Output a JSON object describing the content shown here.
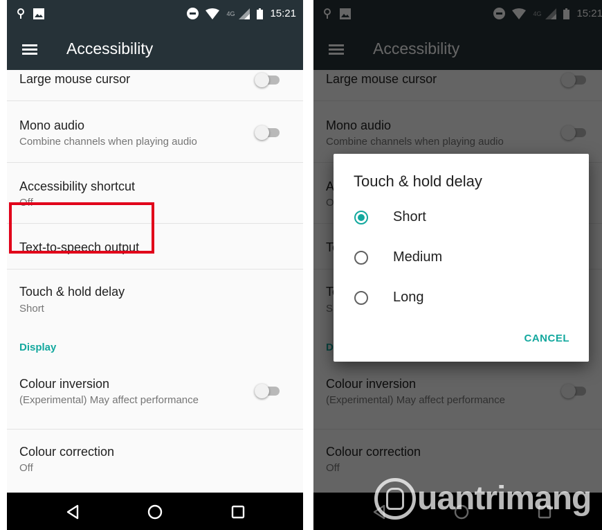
{
  "status_bar": {
    "time": "15:21",
    "network": "4G"
  },
  "app_bar": {
    "title": "Accessibility"
  },
  "settings": {
    "large_mouse_cursor": {
      "title": "Large mouse cursor"
    },
    "mono_audio": {
      "title": "Mono audio",
      "summary": "Combine channels when playing audio"
    },
    "accessibility_shortcut": {
      "title": "Accessibility shortcut",
      "summary": "Off"
    },
    "tts_output": {
      "title": "Text-to-speech output"
    },
    "touch_hold_delay": {
      "title": "Touch & hold delay",
      "summary": "Short"
    },
    "display_header": "Display",
    "colour_inversion": {
      "title": "Colour inversion",
      "summary": "(Experimental) May affect performance"
    },
    "colour_correction": {
      "title": "Colour correction",
      "summary": "Off"
    }
  },
  "dialog": {
    "title": "Touch & hold delay",
    "options": [
      {
        "label": "Short",
        "selected": true
      },
      {
        "label": "Medium",
        "selected": false
      },
      {
        "label": "Long",
        "selected": false
      }
    ],
    "cancel_label": "CANCEL"
  },
  "watermark": {
    "text": "uantrimang"
  },
  "colors": {
    "app_bar": "#263238",
    "accent": "#13a89e",
    "highlight_border": "#e1001a",
    "nav_bar": "#000000"
  },
  "icons": {
    "status_left": [
      "location-pin-icon",
      "image-icon"
    ],
    "status_right": [
      "do-not-disturb-icon",
      "wifi-icon",
      "signal-icon",
      "battery-icon"
    ],
    "navigation": [
      "back-icon",
      "home-icon",
      "recents-icon"
    ],
    "app_bar": "menu-icon"
  }
}
